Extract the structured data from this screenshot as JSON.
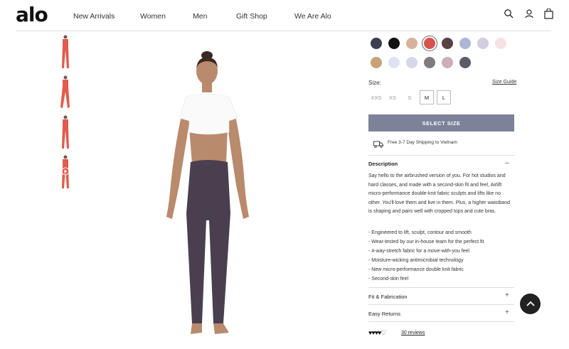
{
  "header": {
    "logo": "alo",
    "nav": [
      "New Arrivals",
      "Women",
      "Men",
      "Gift Shop",
      "We Are Alo"
    ],
    "icons": [
      "search-icon",
      "account-icon",
      "shopping-bag-icon"
    ]
  },
  "gallery": {
    "thumbnail_count": 4,
    "main_image": "model wearing cropped white tee and dark leggings"
  },
  "colors": {
    "swatches_row1": [
      "#3b3f52",
      "#111111",
      "#d6b39a",
      "#d9534f",
      "#5a4144",
      "#aeb6d8",
      "#d3cde0",
      "#f6e1e6"
    ],
    "swatches_row2": [
      "#c9a27c",
      "#dde3f3",
      "#d6d6e8",
      "#7f7b80",
      "#cfaeb8",
      "#5b5d66"
    ],
    "selected_index": 3
  },
  "size": {
    "label": "Size:",
    "guide": "Size Guide",
    "options": [
      "XXS",
      "XS",
      "S",
      "M",
      "L"
    ],
    "boxed": [
      "M",
      "L"
    ]
  },
  "cta": {
    "select_size": "SELECT SIZE"
  },
  "shipping": {
    "text": "Free 3-7 Day Shipping to Vietnam"
  },
  "description": {
    "title": "Description",
    "toggle": "–",
    "body": "Say hello to the airbrushed version of you. For hot studios and hard classes, and made with a second-skin fit and feel, Airlift micro-performance double-knit fabric sculpts and lifts like no other. You'll love them and live in them. Plus, a higher waistband is shaping and pairs well with cropped tops and cute bras.",
    "bullets": [
      "- Engineered to lift, sculpt, contour and smooth",
      "- Wear-tested by our in-house team for the perfect fit",
      "- 4-way-stretch fabric for a move-with-you feel",
      "- Moisture-wicking antimicrobial technology",
      "- New micro-performance double knit fabric",
      "- Second-skin feel"
    ]
  },
  "accordions": [
    {
      "title": "Fit & Fabrication",
      "toggle": "+"
    },
    {
      "title": "Easy Returns",
      "toggle": "+"
    }
  ],
  "rating": {
    "stars": "♥♥♥♥♡",
    "reviews": "30 reviews"
  }
}
